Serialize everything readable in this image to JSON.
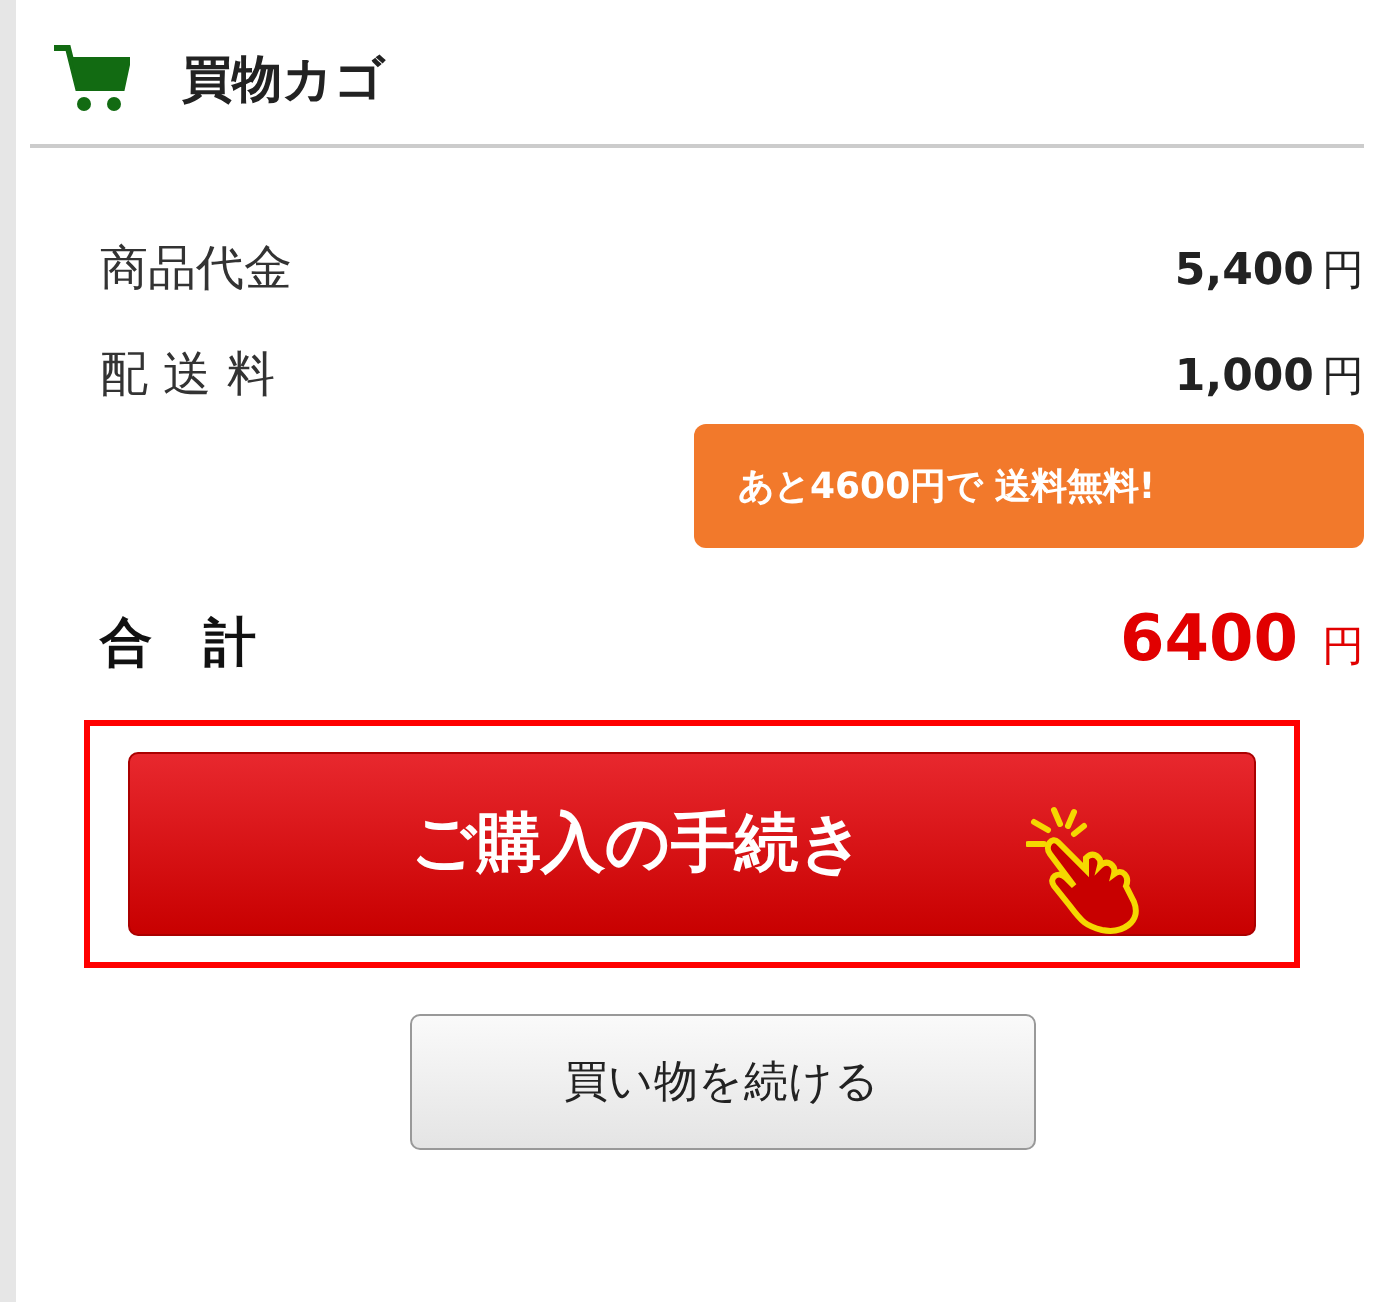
{
  "header": {
    "title": "買物カゴ"
  },
  "lines": [
    {
      "label": "商品代金",
      "amount": "5,400",
      "unit": "円"
    },
    {
      "label": "配 送 料",
      "amount": "1,000",
      "unit": "円"
    }
  ],
  "notice": {
    "text": "あと4600円で **送料無料!**"
  },
  "total": {
    "label": "合　計",
    "amount": "6400",
    "unit": "円"
  },
  "buttons": [
    {
      "label": "ご購入の手続き",
      "kind": "primary"
    },
    {
      "label": "買い物を続ける",
      "kind": "secondary"
    }
  ]
}
